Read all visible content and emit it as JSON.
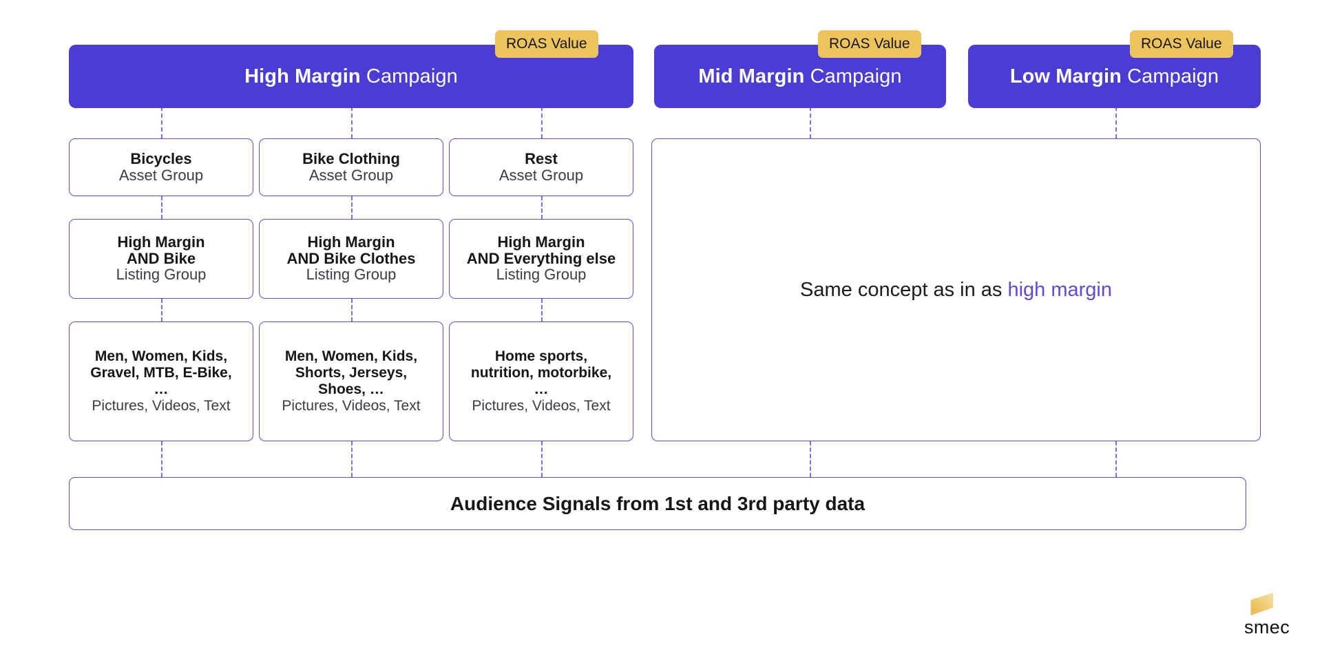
{
  "colors": {
    "campaign_purple": "#4B3DD4",
    "border_purple": "#5B4BD6",
    "connector_purple": "#7B6FE0",
    "roas_gold": "#EDC35C",
    "accent_link": "#5B4BD6",
    "title_text": "#16151a",
    "subtitle_text": "#3b3b44",
    "logo_gold": "#EFC45A"
  },
  "campaigns": [
    {
      "name_bold": "High Margin",
      "name_light": "Campaign",
      "badge": "ROAS Value"
    },
    {
      "name_bold": "Mid Margin",
      "name_light": "Campaign",
      "badge": "ROAS Value"
    },
    {
      "name_bold": "Low Margin",
      "name_light": "Campaign",
      "badge": "ROAS Value"
    }
  ],
  "asset_groups": [
    {
      "title": "Bicycles",
      "subtitle": "Asset Group"
    },
    {
      "title": "Bike Clothing",
      "subtitle": "Asset Group"
    },
    {
      "title": "Rest",
      "subtitle": "Asset Group"
    }
  ],
  "listing_groups": [
    {
      "line1": "High Margin",
      "line2": "AND Bike",
      "subtitle": "Listing Group"
    },
    {
      "line1": "High Margin",
      "line2": "AND Bike Clothes",
      "subtitle": "Listing Group"
    },
    {
      "line1": "High Margin",
      "line2": "AND Everything else",
      "subtitle": "Listing Group"
    }
  ],
  "assets": [
    {
      "line1": "Men, Women, Kids,",
      "line2": "Gravel, MTB, E-Bike,",
      "line3": "",
      "dots": "…",
      "footer": "Pictures, Videos, Text"
    },
    {
      "line1": "Men, Women, Kids,",
      "line2": "Shorts, Jerseys,",
      "line3": "Shoes, …",
      "dots": "",
      "footer": "Pictures, Videos, Text"
    },
    {
      "line1": "Home sports,",
      "line2": "nutrition, motorbike,",
      "line3": "",
      "dots": "…",
      "footer": "Pictures, Videos, Text"
    }
  ],
  "right_panel": {
    "prefix": "Same concept as in as ",
    "link": "high margin"
  },
  "audience": {
    "label": "Audience Signals from 1st and 3rd party data"
  },
  "logo": {
    "wordmark": "smec"
  }
}
